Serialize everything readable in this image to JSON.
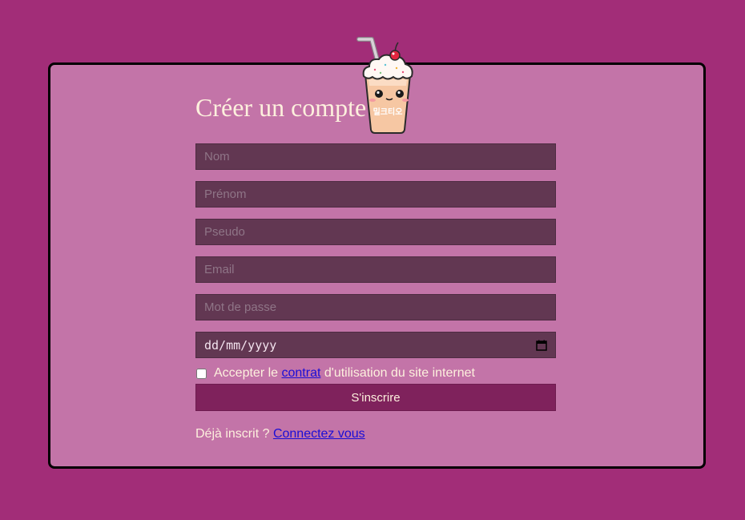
{
  "form": {
    "title": "Créer un compte",
    "fields": {
      "nom_placeholder": "Nom",
      "prenom_placeholder": "Prénom",
      "pseudo_placeholder": "Pseudo",
      "email_placeholder": "Email",
      "password_placeholder": "Mot de passe",
      "date_placeholder": "dd/mm/yyyy"
    },
    "terms": {
      "prefix": "Accepter le",
      "link": "contrat",
      "suffix": "d'utilisation du site internet",
      "checked": false
    },
    "submit_label": "S'inscrire",
    "login_prompt": "Déjà inscrit ?",
    "login_link": "Connectez vous"
  },
  "mascot": {
    "icon": "milkshake-mascot-icon",
    "text": "밀크티오"
  },
  "colors": {
    "background": "#a22d78",
    "card": "#c374a8",
    "field": "#623752",
    "button": "#7f225c",
    "text": "#fdf0dd",
    "link": "#1a0dd6"
  }
}
